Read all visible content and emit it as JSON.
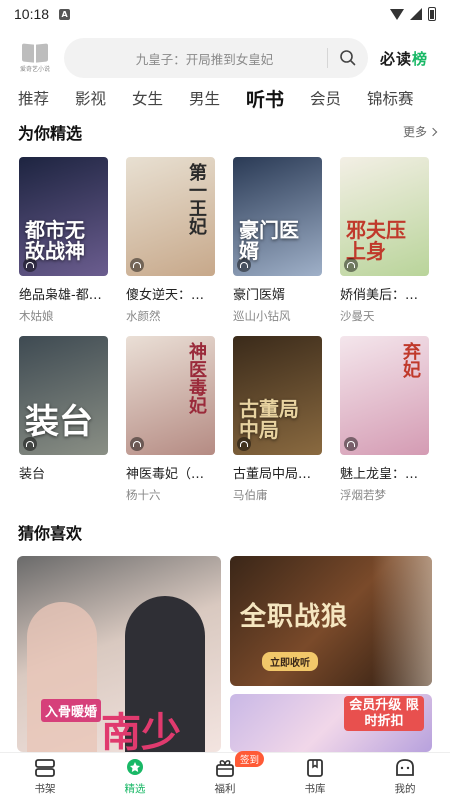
{
  "status_bar": {
    "time": "10:18",
    "sim_label": "A"
  },
  "header": {
    "logo_text": "爱奇艺小说",
    "search_placeholder": "九皇子：开局推到女皇妃",
    "must_read": "必读",
    "must_read_accent": "榜"
  },
  "tabs": [
    "推荐",
    "影视",
    "女生",
    "男生",
    "听书",
    "会员",
    "锦标赛"
  ],
  "active_tab": "听书",
  "picks": {
    "title": "为你精选",
    "more_label": "更多",
    "books": [
      {
        "title": "绝品枭雄-都…",
        "author": "木姑娘",
        "cover_text": "都市无敌战神",
        "colors": [
          "#1d2440",
          "#6b5d8f"
        ]
      },
      {
        "title": "傻女逆天：…",
        "author": "水颜然",
        "cover_text": "第一王妃",
        "colors": [
          "#e8e0d2",
          "#c7a88a"
        ]
      },
      {
        "title": "豪门医婿",
        "author": "巡山小钻风",
        "cover_text": "豪门医婿",
        "colors": [
          "#2a3a55",
          "#9fb0c8"
        ]
      },
      {
        "title": "娇俏美后：…",
        "author": "沙曼天",
        "cover_text": "邪夫压上身",
        "colors": [
          "#f3efe5",
          "#b9d49a"
        ]
      },
      {
        "title": "装台",
        "author": "",
        "cover_text": "装台",
        "colors": [
          "#3e4a52",
          "#8a8f85"
        ]
      },
      {
        "title": "神医毒妃（…",
        "author": "杨十六",
        "cover_text": "神医毒妃",
        "colors": [
          "#eadfd6",
          "#b58b83"
        ]
      },
      {
        "title": "古董局中局…",
        "author": "马伯庸",
        "cover_text": "古董局中局",
        "colors": [
          "#3a2a1a",
          "#8a6a40"
        ]
      },
      {
        "title": "魅上龙皇：…",
        "author": "浮烟若梦",
        "cover_text": "弃妃",
        "colors": [
          "#f4e6ec",
          "#d49bb3"
        ]
      }
    ]
  },
  "guess": {
    "title": "猜你喜欢",
    "banners": [
      {
        "text": "南少",
        "tag": "入骨暖婚"
      },
      {
        "text": "全职战狼",
        "tag": "立即收听"
      },
      {
        "text": "会员升级 限时折扣",
        "tag": ""
      }
    ]
  },
  "bottom_nav": [
    {
      "label": "书架",
      "icon": "bookshelf-icon"
    },
    {
      "label": "精选",
      "icon": "featured-icon"
    },
    {
      "label": "福利",
      "icon": "gift-icon",
      "badge": "签到"
    },
    {
      "label": "书库",
      "icon": "library-icon"
    },
    {
      "label": "我的",
      "icon": "profile-icon"
    }
  ],
  "colors": {
    "accent": "#19b866",
    "badge": "#ff5a36"
  }
}
